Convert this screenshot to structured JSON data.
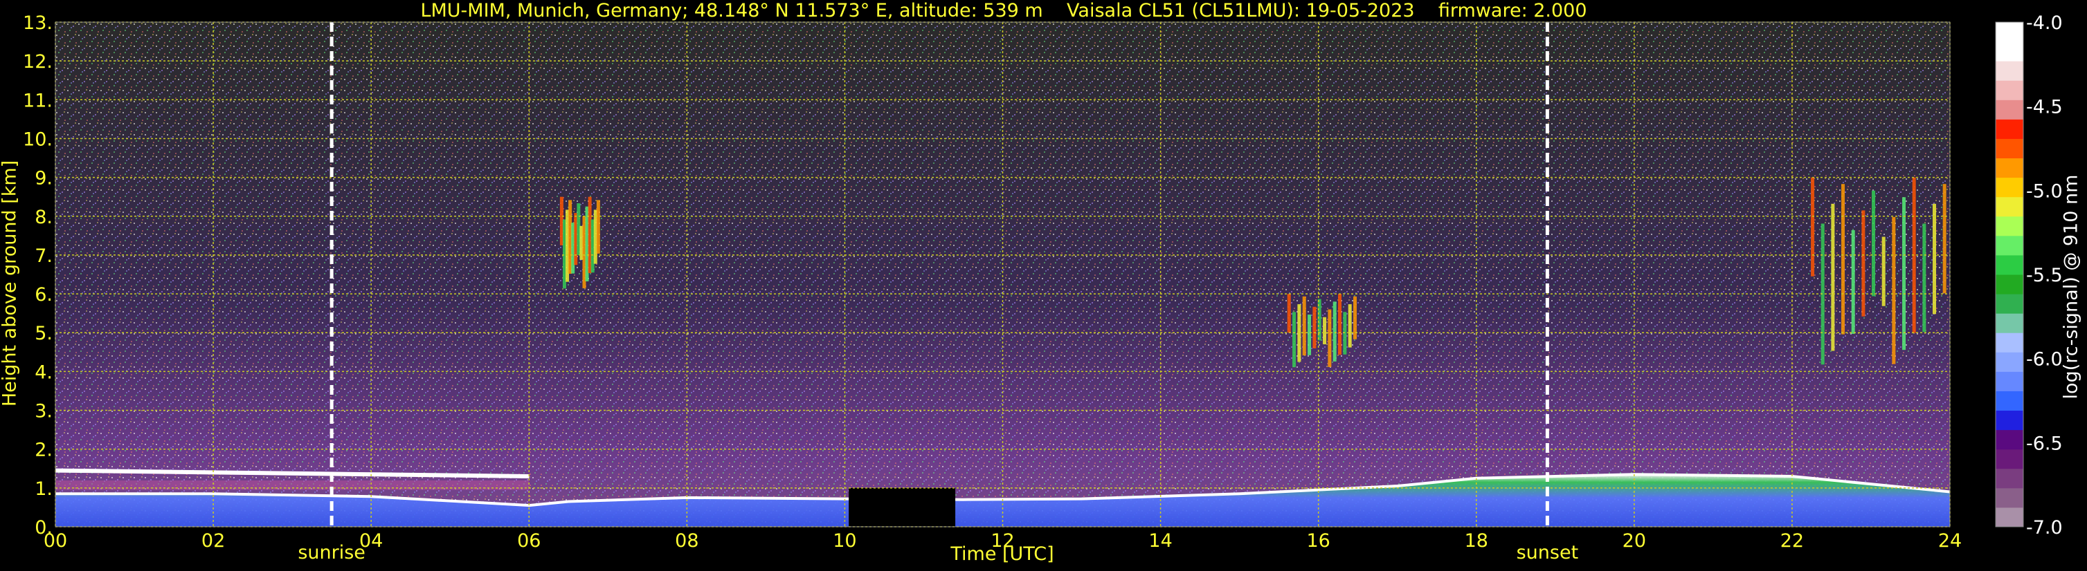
{
  "chart_data": {
    "type": "heatmap",
    "title": "LMU-MIM, Munich, Germany; 48.148° N 11.573° E, altitude: 539 m    Vaisala CL51 (CL51LMU): 19-05-2023    firmware: 2.000",
    "xlabel": "Time [UTC]",
    "ylabel": "Height above ground [km]",
    "xlim": [
      0,
      24
    ],
    "ylim": [
      0,
      13
    ],
    "x_ticks": [
      "00",
      "02",
      "04",
      "06",
      "08",
      "10",
      "12",
      "14",
      "16",
      "18",
      "20",
      "22",
      "24"
    ],
    "y_ticks": [
      "0.",
      "1.",
      "2.",
      "3.",
      "4.",
      "5.",
      "6.",
      "7.",
      "8.",
      "9.",
      "10.",
      "11.",
      "12.",
      "13."
    ],
    "grid": true,
    "annotations": [
      {
        "label": "sunrise",
        "x": 3.5
      },
      {
        "label": "sunset",
        "x": 18.9
      }
    ],
    "data_gap": {
      "x_start": 10.05,
      "x_end": 11.4,
      "y_max": 1.0
    },
    "boundary_layer_top_km": [
      {
        "x": 0,
        "y": 0.85
      },
      {
        "x": 2,
        "y": 0.85
      },
      {
        "x": 4,
        "y": 0.78
      },
      {
        "x": 6,
        "y": 0.55
      },
      {
        "x": 6.5,
        "y": 0.65
      },
      {
        "x": 8,
        "y": 0.75
      },
      {
        "x": 10,
        "y": 0.72
      },
      {
        "x": 11.5,
        "y": 0.7
      },
      {
        "x": 13,
        "y": 0.72
      },
      {
        "x": 15,
        "y": 0.85
      },
      {
        "x": 17,
        "y": 1.05
      },
      {
        "x": 18,
        "y": 1.25
      },
      {
        "x": 19,
        "y": 1.3
      },
      {
        "x": 20,
        "y": 1.35
      },
      {
        "x": 22,
        "y": 1.3
      },
      {
        "x": 24,
        "y": 0.9
      }
    ],
    "residual_layer_km": {
      "x_start": 0,
      "x_end": 6,
      "y_start": 1.45,
      "y_end": 1.3
    },
    "cloud_regions": [
      {
        "x_start": 15.6,
        "x_end": 16.5,
        "y_bottom": 4.0,
        "y_top": 6.0
      },
      {
        "x_start": 22.2,
        "x_end": 24,
        "y_bottom": 3.9,
        "y_top": 9.0
      },
      {
        "x_start": 6.4,
        "x_end": 6.9,
        "y_bottom": 6.0,
        "y_top": 8.5
      }
    ],
    "colorbar": {
      "label": "log(rc-signal) @ 910 nm",
      "min": -7.0,
      "max": -4.0,
      "ticks": [
        "-4.0",
        "-4.5",
        "-5.0",
        "-5.5",
        "-6.0",
        "-6.5",
        "-7.0"
      ],
      "colors": [
        "#a990a8",
        "#8a5f8a",
        "#7a3d80",
        "#6a1a7a",
        "#5a0a80",
        "#2020e0",
        "#3366ff",
        "#6688ff",
        "#8aa6ff",
        "#a9bfff",
        "#76c7a8",
        "#30b050",
        "#22aa22",
        "#2ccc44",
        "#66ee66",
        "#aaff55",
        "#eeee33",
        "#ffcc00",
        "#ff9900",
        "#ff5500",
        "#ff2200",
        "#e88d8d",
        "#f2b8b8",
        "#f5dddd",
        "#ffffff",
        "#ffffff"
      ]
    }
  }
}
